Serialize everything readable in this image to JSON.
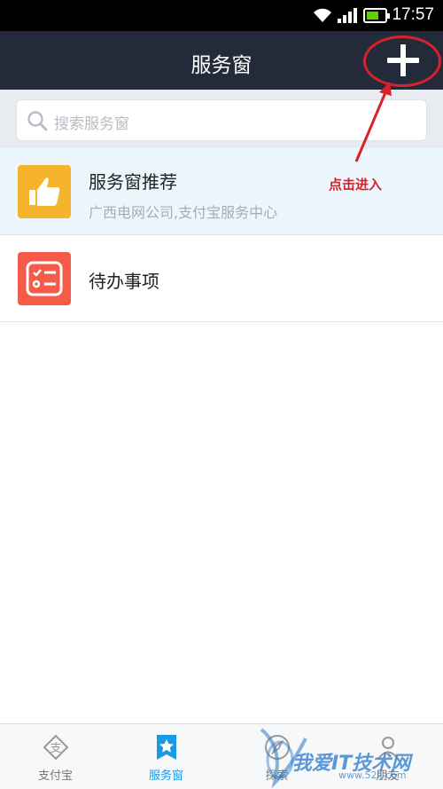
{
  "status_bar": {
    "time": "17:57"
  },
  "header": {
    "title": "服务窗"
  },
  "search": {
    "placeholder": "搜索服务窗"
  },
  "list": [
    {
      "title": "服务窗推荐",
      "subtitle": "广西电网公司,支付宝服务中心"
    },
    {
      "title": "待办事项"
    }
  ],
  "annotation": {
    "text": "点击进入"
  },
  "tabs": [
    {
      "label": "支付宝"
    },
    {
      "label": "服务窗"
    },
    {
      "label": "探索"
    },
    {
      "label": "朋友"
    }
  ],
  "watermark": {
    "text": "我爱IT技术网",
    "url": "www.52ij.com"
  },
  "colors": {
    "header_bg": "#232a3a",
    "accent": "#1a9ae6",
    "annotation": "#d8222a",
    "recommend_icon": "#f6b42c",
    "todo_icon": "#f55b48"
  }
}
